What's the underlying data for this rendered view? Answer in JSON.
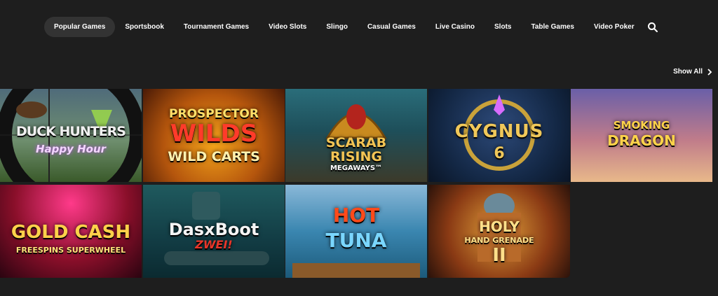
{
  "nav": {
    "items": [
      {
        "label": "Popular Games",
        "active": true
      },
      {
        "label": "Sportsbook"
      },
      {
        "label": "Tournament Games"
      },
      {
        "label": "Video Slots"
      },
      {
        "label": "Slingo"
      },
      {
        "label": "Casual Games"
      },
      {
        "label": "Live Casino"
      },
      {
        "label": "Slots"
      },
      {
        "label": "Table Games"
      },
      {
        "label": "Video Poker"
      }
    ],
    "search_icon": "search-icon"
  },
  "show_all": {
    "label": "Show All",
    "icon": "chevron-right-icon"
  },
  "games": [
    {
      "title": "DUCK HUNTERS",
      "subtitle": "Happy Hour"
    },
    {
      "title": "PROSPECTOR",
      "subtitle": "WILDS",
      "extra": "WILD CARTS"
    },
    {
      "title": "SCARAB",
      "subtitle": "RISING",
      "extra": "MEGAWAYS™"
    },
    {
      "title": "CYGNUS",
      "subtitle": "6"
    },
    {
      "title": "SMOKING",
      "subtitle": "DRAGON"
    },
    {
      "title": "GOLD CASH",
      "subtitle": "FREESPINS SUPERWHEEL"
    },
    {
      "title": "DasxBoot",
      "subtitle": "ZWEI!"
    },
    {
      "title": "HOT",
      "subtitle": "TUNA"
    },
    {
      "title": "HOLY",
      "subtitle": "HAND GRENADE",
      "extra": "II"
    }
  ],
  "colors": {
    "background": "#1e1e1e",
    "nav_active_bg": "#333333"
  }
}
